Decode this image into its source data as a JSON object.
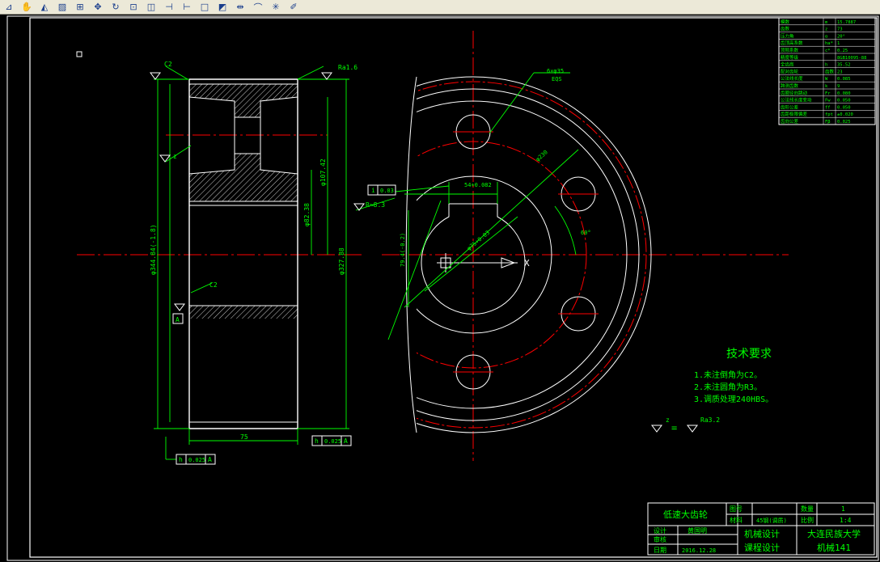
{
  "toolbar": {
    "icons": [
      "mirror-icon",
      "pan-icon",
      "mirror-text-icon",
      "hatch-icon",
      "grid-icon",
      "move-icon",
      "rotate-icon",
      "scale-icon",
      "stretch-icon",
      "trim-icon",
      "extend-icon",
      "break-icon",
      "chamfer-icon",
      "join-icon",
      "fillet-icon",
      "explode-icon",
      "erase-icon"
    ]
  },
  "colors": {
    "bg": "#000000",
    "green": "#00ff00",
    "red": "#ff0000",
    "white": "#ffffff",
    "cyan": "#00ffff",
    "yellow": "#ffff00"
  },
  "drawing": {
    "roughness_top": "Ra1.6",
    "chamfer_c2_top": "C2",
    "chamfer_c2_mid": "C2",
    "roughness_z": "z",
    "roughness_x": "x",
    "dim_width": "75",
    "dim_diam_left": "φ344.84(-1.8)",
    "dim_diam_right": "φ327.88",
    "dim_hub1": "φ107.42",
    "dim_hub2": "φ82.38",
    "dim_key": "54+0.082",
    "dim_bore": "φ75+0.03",
    "dim_key_depth": "79.4(-0.2)",
    "dim_holes": "6×φ35",
    "dim_holes_eq": "EQS",
    "dim_pcd": "φ230",
    "dim_angle": "60°",
    "fillet_note": "R≈8.3",
    "tol_circ_label": "i",
    "tol_circ_value": "0.03",
    "tol_bottom_label": "h",
    "tol_bottom_value": "0.025",
    "tol_bottom_datum": "A",
    "tol_right_label": "h",
    "tol_right_value": "0.025",
    "tol_right_datum": "A",
    "datum_mark": "A",
    "roughness_eq_left": "z",
    "roughness_eq_sign": "=",
    "roughness_eq_right": "Ra3.2"
  },
  "tech_req": {
    "title": "技术要求",
    "items": [
      "1.未注倒角为C2。",
      "2.未注圆角为R3。",
      "3.调质处理240HBS。"
    ]
  },
  "param_table": {
    "rows": [
      [
        "模数",
        "m",
        "15.7887"
      ],
      [
        "齿数",
        "z",
        "73"
      ],
      [
        "压力角",
        "α",
        "20°"
      ],
      [
        "齿顶高系数",
        "ha*",
        "1"
      ],
      [
        "顶隙系数",
        "c*",
        "0.25"
      ],
      [
        "精度等级",
        "",
        "8GB10095-88"
      ],
      [
        "全齿高",
        "h",
        "35.52"
      ],
      [
        "配对齿轮",
        "齿数",
        "23"
      ],
      [
        "公法线长度",
        "W",
        "0.085"
      ],
      [
        "跨测齿数",
        "k",
        "9"
      ],
      [
        "齿圈径向跳动",
        "Fr",
        "0.080"
      ],
      [
        "公法线长度变动",
        "Fw",
        "0.050"
      ],
      [
        "齿形公差",
        "ff",
        "0.050"
      ],
      [
        "齿距极限偏差",
        "fpt",
        "±0.020"
      ],
      [
        "齿向公差",
        "Fβ",
        "0.025"
      ]
    ]
  },
  "title_block": {
    "part_name": "低速大齿轮",
    "drawing_no_label": "图号",
    "material_label": "材料",
    "material_value": "45钢(调质)",
    "quantity_label": "数量",
    "quantity_value": "1",
    "scale_label": "比例",
    "scale_value": "1:4",
    "designer_label": "设计",
    "designer_value": "黄国明",
    "reviewer_label": "审核",
    "date_label": "日期",
    "date_value": "2016.12.28",
    "course": "机械设计",
    "course2": "课程设计",
    "school": "大连民族大学",
    "class": "机械141"
  }
}
